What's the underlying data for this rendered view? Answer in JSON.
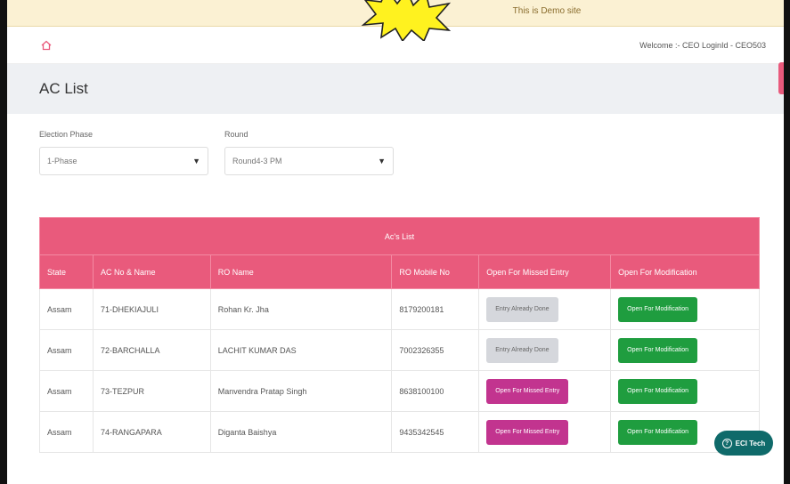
{
  "banner": {
    "text": "This is Demo site"
  },
  "header": {
    "welcome": "Welcome :- CEO LoginId - CEO503"
  },
  "page": {
    "title": "AC List"
  },
  "filters": {
    "phase_label": "Election Phase",
    "phase_value": "1-Phase",
    "round_label": "Round",
    "round_value": "Round4-3 PM"
  },
  "table": {
    "title": "Ac's List",
    "headers": [
      "State",
      "AC No & Name",
      "RO Name",
      "RO Mobile No",
      "Open For Missed Entry",
      "Open For Modification"
    ],
    "rows": [
      {
        "state": "Assam",
        "ac": "71-DHEKIAJULI",
        "ro": "Rohan Kr. Jha",
        "mobile": "8179200181",
        "missed": "Entry Already Done",
        "missed_style": "gray",
        "modification": "Open For Modification"
      },
      {
        "state": "Assam",
        "ac": "72-BARCHALLA",
        "ro": "LACHIT KUMAR DAS",
        "mobile": "7002326355",
        "missed": "Entry Already Done",
        "missed_style": "gray",
        "modification": "Open For Modification"
      },
      {
        "state": "Assam",
        "ac": "73-TEZPUR",
        "ro": "Manvendra Pratap Singh",
        "mobile": "8638100100",
        "missed": "Open For Missed Entry",
        "missed_style": "magenta",
        "modification": "Open For Modification"
      },
      {
        "state": "Assam",
        "ac": "74-RANGAPARA",
        "ro": "Diganta Baishya",
        "mobile": "9435342545",
        "missed": "Open For Missed Entry",
        "missed_style": "magenta",
        "modification": "Open For Modification"
      }
    ]
  },
  "chat": {
    "label": "ECI Tech",
    "icon": "question-icon"
  },
  "colors": {
    "accent": "#e95a7c",
    "green": "#1f9d3f",
    "magenta": "#c2348f",
    "banner": "#fbf1d3"
  }
}
